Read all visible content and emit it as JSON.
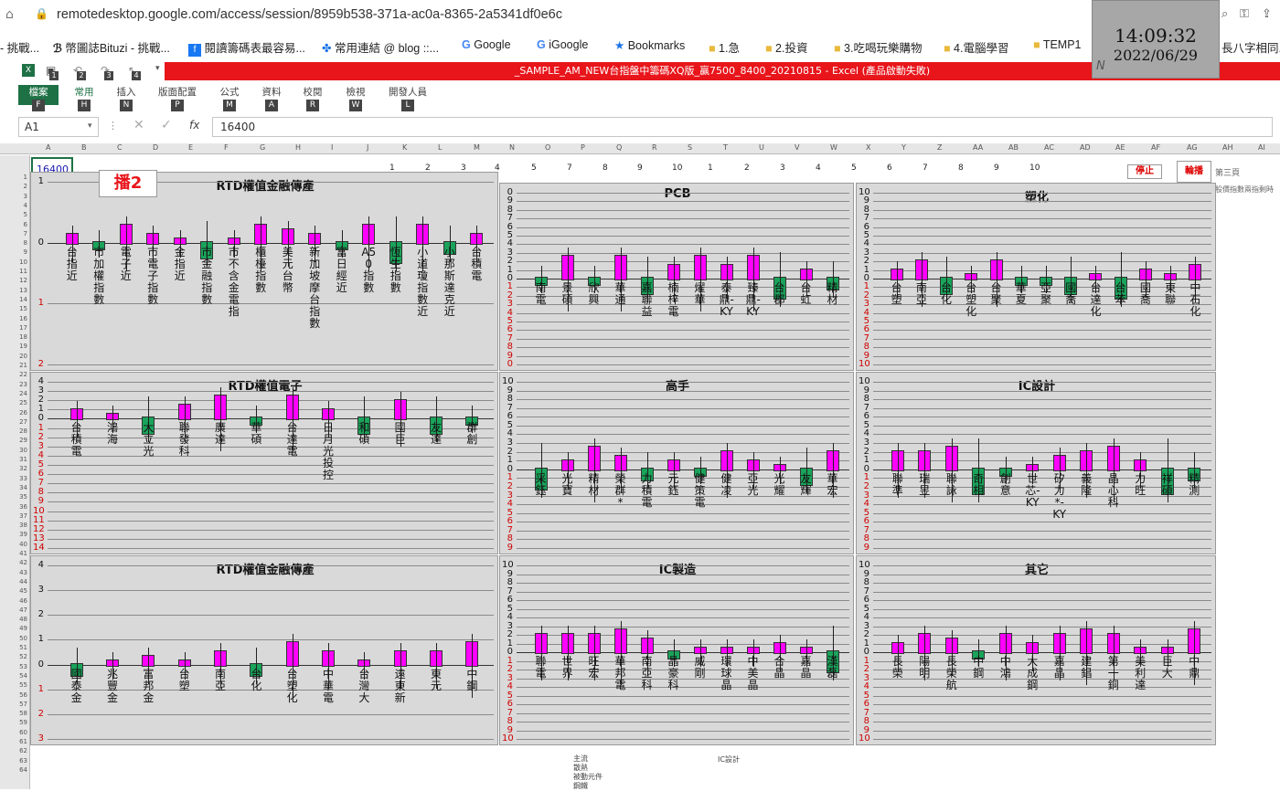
{
  "browser": {
    "url": "remotedesktop.google.com/access/session/8959b538-371a-ac0a-8365-2a5341df0e6c"
  },
  "bookmarks": [
    "- 挑戰...",
    "幣圖誌Bituzi - 挑戰...",
    "閱讀籌碼表最容易...",
    "常用連結 @ blog ::...",
    "Google",
    "iGoogle",
    "Bookmarks",
    "1.急",
    "2.投資",
    "3.吃喝玩樂購物",
    "4.電腦學習",
    "TEMP1",
    "長八字相同..."
  ],
  "clock": {
    "time": "14:09:32",
    "date": "2022/06/29",
    "badge": "N"
  },
  "excel": {
    "title": "_SAMPLE_AM_NEW台指盤中籌碼XQ版_贏7500_8400_20210815 - Excel (產品啟動失敗)",
    "tabs": [
      {
        "label": "檔案",
        "key": "F"
      },
      {
        "label": "常用",
        "key": "H"
      },
      {
        "label": "插入",
        "key": "N"
      },
      {
        "label": "版面配置",
        "key": "P"
      },
      {
        "label": "公式",
        "key": "M"
      },
      {
        "label": "資料",
        "key": "A"
      },
      {
        "label": "校閱",
        "key": "R"
      },
      {
        "label": "檢視",
        "key": "W"
      },
      {
        "label": "開發人員",
        "key": "L"
      }
    ],
    "qat_keys": [
      "1",
      "2",
      "3",
      "4"
    ],
    "namebox": "A1",
    "formula": "16400",
    "cell_a1": "16400",
    "col_headers": [
      "A",
      "B",
      "C",
      "D",
      "E",
      "F",
      "G",
      "H",
      "I",
      "J",
      "K",
      "L",
      "M",
      "N",
      "O",
      "P",
      "Q",
      "R",
      "S",
      "T",
      "U",
      "V",
      "W",
      "X",
      "Y",
      "Z",
      "AA",
      "AB",
      "AC",
      "AD",
      "AE",
      "AF",
      "AG",
      "AH",
      "AI"
    ],
    "num_row": [
      "1",
      "2",
      "3",
      "4",
      "5",
      "7",
      "8",
      "9",
      "10",
      "1",
      "2",
      "3",
      "4",
      "5",
      "6",
      "7",
      "8",
      "9",
      "10"
    ],
    "buttons": {
      "play2": "播2",
      "stop": "停止",
      "rotate": "輪播",
      "page": "第三頁",
      "note": "股價指數兩指剩時"
    },
    "bottom_notes": [
      "主流",
      "散熱",
      "被動元件",
      "鋼鐵"
    ],
    "bottom_note2": "IC設計"
  },
  "panels": [
    {
      "id": "fin1",
      "title": "RTD權值金融傳產",
      "yt": [
        "1",
        "0",
        "1",
        "2"
      ],
      "stocks": [
        "台指近",
        "市加權指數",
        "電子近",
        "市電子指數",
        "金指近",
        "市金融指數",
        "市不含金電指",
        "櫃檯指數",
        "美元台幣",
        "新加坡摩台指數",
        "富日經近",
        "A50指數",
        "恆生指數",
        "小道瓊指數近",
        "小那斯達克近",
        "台積電"
      ]
    },
    {
      "id": "pcb",
      "title": "PCB",
      "yt": [
        "0",
        "9",
        "8",
        "7",
        "6",
        "5",
        "4",
        "3",
        "2",
        "1",
        "0",
        "1",
        "2",
        "3",
        "4",
        "5",
        "6",
        "7",
        "8",
        "9",
        "0"
      ],
      "stocks": [
        "南電",
        "景碩",
        "欣興",
        "華通",
        "嘉聯益",
        "楠梓電",
        "燿華",
        "泰鼎-KY",
        "臻鼎-KY",
        "台郡",
        "台虹",
        "精材"
      ]
    },
    {
      "id": "plastic",
      "title": "塑化",
      "yt": [
        "10",
        "9",
        "8",
        "7",
        "6",
        "5",
        "4",
        "3",
        "2",
        "1",
        "0",
        "1",
        "2",
        "3",
        "4",
        "5",
        "6",
        "7",
        "8",
        "9",
        "10"
      ],
      "stocks": [
        "台塑",
        "南亞",
        "台化",
        "台塑化",
        "台聚",
        "華夏",
        "亞聚",
        "國喬",
        "台達化",
        "台苯",
        "國喬",
        "東聯",
        "中石化"
      ]
    },
    {
      "id": "elec",
      "title": "RTD權值電子",
      "yt": [
        "4",
        "3",
        "2",
        "1",
        "0",
        "1",
        "2",
        "3",
        "4",
        "5",
        "6",
        "7",
        "8",
        "9",
        "10",
        "11",
        "12",
        "13",
        "14"
      ],
      "stocks": [
        "台積電",
        "鴻海",
        "大立光",
        "聯發科",
        "廣達",
        "華碩",
        "台達電",
        "日月光投控",
        "和碩",
        "國巨",
        "友達",
        "群創"
      ]
    },
    {
      "id": "master",
      "title": "高手",
      "yt": [
        "10",
        "9",
        "8",
        "7",
        "6",
        "5",
        "4",
        "3",
        "2",
        "1",
        "0",
        "1",
        "2",
        "3",
        "4",
        "5",
        "6",
        "7",
        "8",
        "9"
      ],
      "stocks": [
        "采鈺",
        "光寶",
        "精材",
        "榮群*",
        "力積電",
        "元鈺",
        "健策電",
        "健凌",
        "亞光",
        "光耀",
        "友輝",
        "華宏"
      ]
    },
    {
      "id": "icdesign",
      "title": "IC設計",
      "yt": [
        "10",
        "9",
        "8",
        "7",
        "6",
        "5",
        "4",
        "3",
        "2",
        "1",
        "0",
        "1",
        "2",
        "3",
        "4",
        "5",
        "6",
        "7",
        "8",
        "9"
      ],
      "stocks": [
        "聯準",
        "瑞昱",
        "聯詠",
        "奇相",
        "創意",
        "世芯-KY",
        "矽力*-KY",
        "義隆",
        "晶心科",
        "力旺",
        "祥碩",
        "精測"
      ]
    },
    {
      "id": "fin2",
      "title": "RTD權值金融傳產",
      "yt": [
        "4",
        "3",
        "2",
        "1",
        "0",
        "1",
        "2",
        "3"
      ],
      "stocks": [
        "國泰金",
        "兆豐金",
        "富邦金",
        "台塑",
        "南亞",
        "台化",
        "台塑化",
        "中華電",
        "台灣大",
        "遠東新",
        "東元",
        "中鋼"
      ]
    },
    {
      "id": "icmfg",
      "title": "IC製造",
      "yt": [
        "10",
        "9",
        "8",
        "7",
        "6",
        "5",
        "4",
        "3",
        "2",
        "1",
        "0",
        "1",
        "2",
        "3",
        "4",
        "5",
        "6",
        "7",
        "8",
        "9",
        "10"
      ],
      "stocks": [
        "聯電",
        "世界",
        "旺宏",
        "華邦電",
        "南亞科",
        "晶豪科",
        "威剛",
        "環球晶",
        "中美晶",
        "合晶",
        "嘉晶",
        "漢磊"
      ]
    },
    {
      "id": "other",
      "title": "其它",
      "yt": [
        "10",
        "9",
        "8",
        "7",
        "6",
        "5",
        "4",
        "3",
        "2",
        "1",
        "0",
        "1",
        "2",
        "3",
        "4",
        "5",
        "6",
        "7",
        "8",
        "9",
        "10"
      ],
      "stocks": [
        "長榮",
        "陽明",
        "長榮航",
        "中鋼",
        "中鴻",
        "大成鋼",
        "嘉晶",
        "建錩",
        "第一銅",
        "美利達",
        "巨大",
        "中鼎"
      ]
    }
  ],
  "colors": {
    "up": "#ff00ff",
    "down": "#1aa35a",
    "neg_label": "#d00000",
    "title_bar": "#e8151b"
  }
}
